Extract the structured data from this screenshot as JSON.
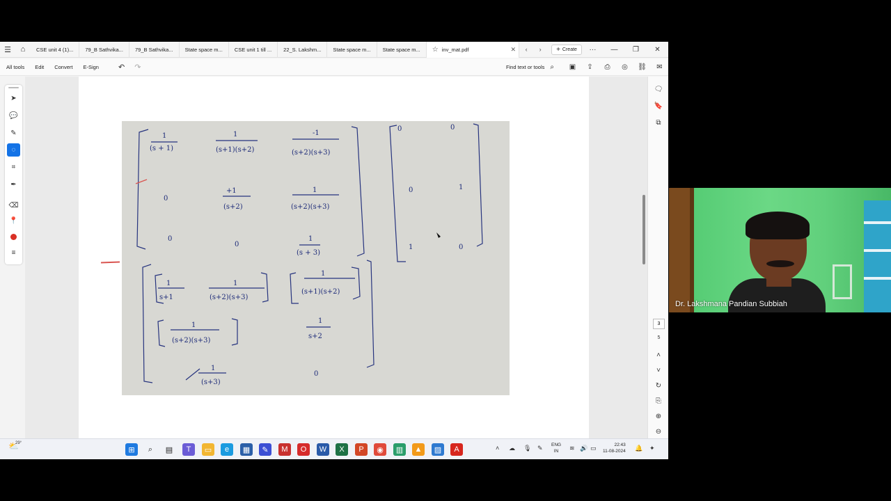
{
  "tabs": [
    {
      "label": "CSE unit 4 (1)..."
    },
    {
      "label": "79_B Sathvika..."
    },
    {
      "label": "79_B Sathvika..."
    },
    {
      "label": "State space m..."
    },
    {
      "label": "CSE unit 1 till ..."
    },
    {
      "label": "22_S. Lakshm..."
    },
    {
      "label": "State space m..."
    },
    {
      "label": "State space m..."
    },
    {
      "label": "inv_mat.pdf"
    }
  ],
  "create_label": "Create",
  "menu": {
    "all_tools": "All tools",
    "edit": "Edit",
    "convert": "Convert",
    "esign": "E-Sign",
    "find": "Find text or tools"
  },
  "page_nav": {
    "current": "3",
    "total": "5"
  },
  "taskbar": {
    "temp": "29°",
    "lang_top": "ENG",
    "lang_bottom": "IN",
    "time": "22:43",
    "date": "11-08-2024"
  },
  "video": {
    "participant_name": "Dr. Lakshmana Pandian Subbiah"
  },
  "handwritten": {
    "r1c1": "1",
    "r1c1d": "(s + 1)",
    "r1c2": "1",
    "r1c2d": "(s+1)(s+2)",
    "r1c3": "-1",
    "r1c3d": "(s+2)(s+3)",
    "r2c1": "0",
    "r2c2": "+1",
    "r2c2d": "(s+2)",
    "r2c3": "1",
    "r2c3d": "(s+2)(s+3)",
    "r3c1": "0",
    "r3c2": "0",
    "r3c3": "1",
    "r3c3d": "(s + 3)",
    "m2a": "0",
    "m2b": "0",
    "m2c": "1",
    "m2d": "1",
    "m2e": "0",
    "m2f": "0",
    "b1": "1",
    "b1d": "s+1",
    "b2": "1",
    "b2d": "(s+2)(s+3)",
    "b3": "1",
    "b3d": "(s+1)(s+2)",
    "b4": "1",
    "b4d": "(s+2)(s+3)",
    "b5": "1",
    "b5d": "s+2",
    "b6": "1",
    "b6d": "(s+3)",
    "b7": "0"
  },
  "colors": {
    "accent": "#1473e6",
    "ink": "#1c2a78"
  }
}
